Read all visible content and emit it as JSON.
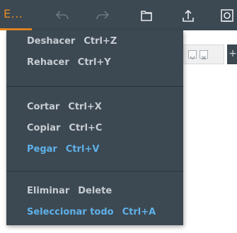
{
  "toolbar": {
    "menu_label": "E...",
    "icons": [
      "undo-icon",
      "redo-icon",
      "folder-icon",
      "upload-icon",
      "settings-icon"
    ]
  },
  "edit_menu": {
    "undo": {
      "label": "Deshacer",
      "shortcut": "Ctrl+Z"
    },
    "redo": {
      "label": "Rehacer",
      "shortcut": "Ctrl+Y"
    },
    "cut": {
      "label": "Cortar",
      "shortcut": "Ctrl+X"
    },
    "copy": {
      "label": "Copiar",
      "shortcut": "Ctrl+C"
    },
    "paste": {
      "label": "Pegar",
      "shortcut": "Ctrl+V"
    },
    "delete": {
      "label": "Eliminar",
      "shortcut": "Delete"
    },
    "select_all": {
      "label": "Seleccionar todo",
      "shortcut": "Ctrl+A"
    }
  },
  "tabstrip": {
    "add_label": "+"
  },
  "colors": {
    "toolbar_bg": "#3c4852",
    "accent": "#e58a24",
    "menu_text": "#c7cdd3",
    "highlight": "#5fb1e8"
  }
}
